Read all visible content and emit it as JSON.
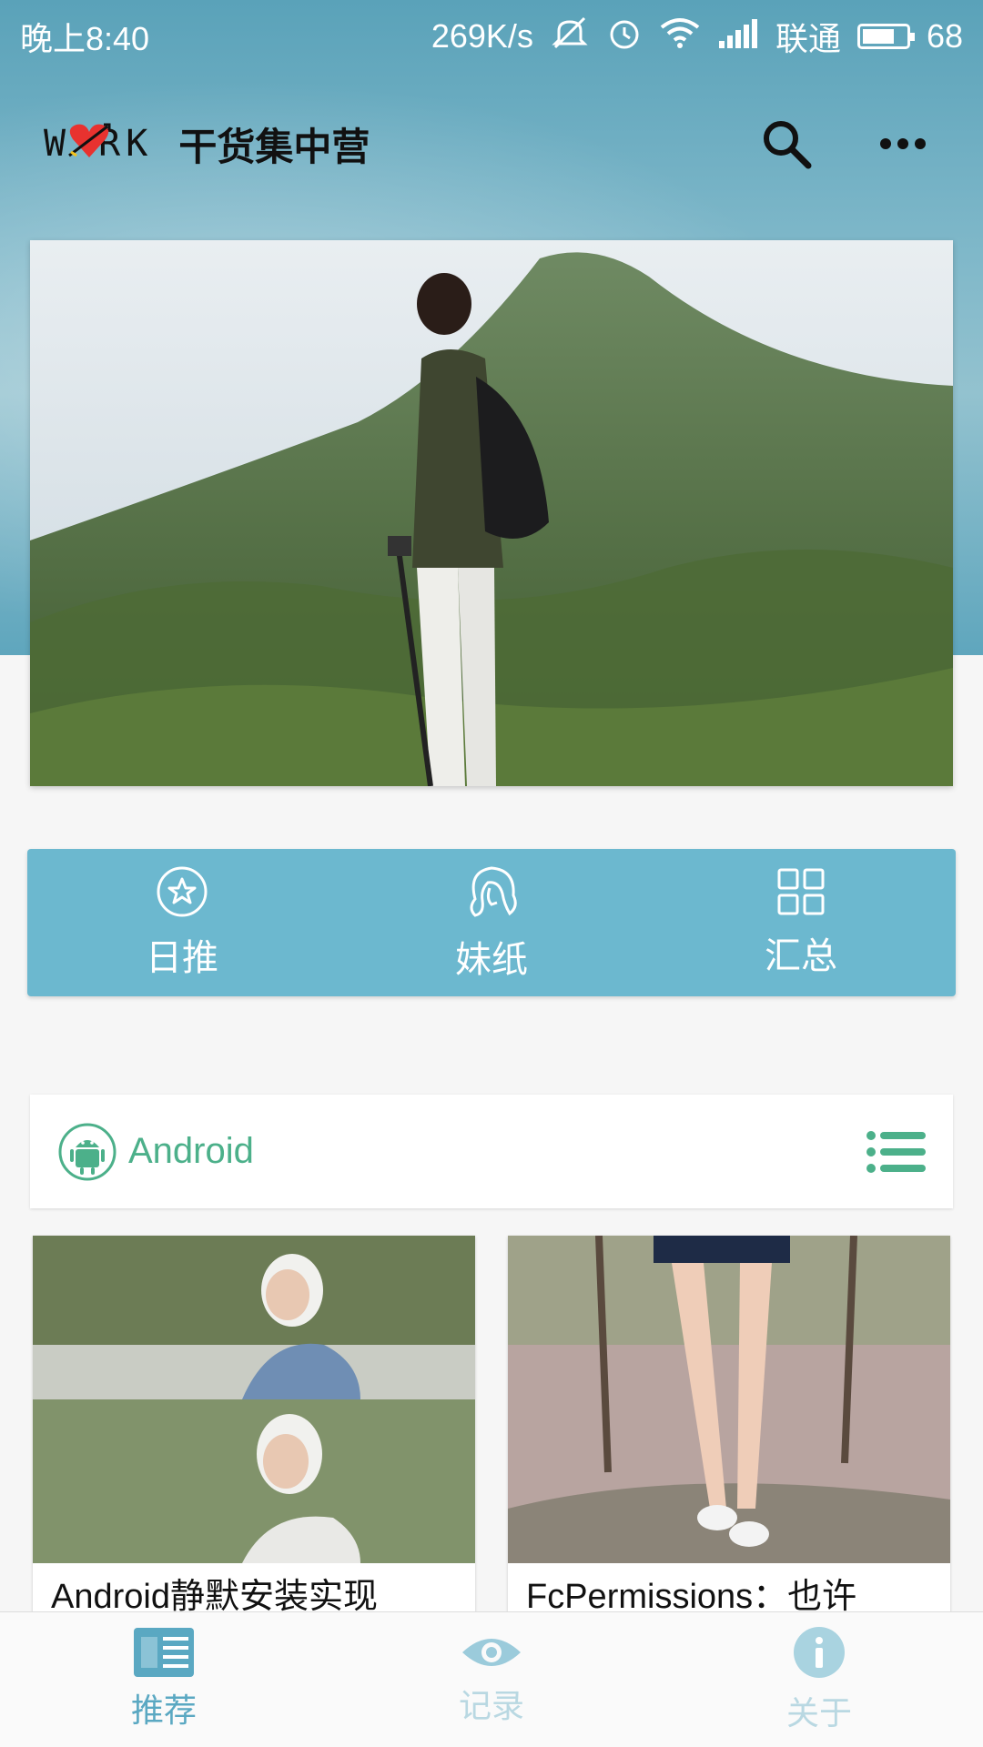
{
  "status_bar": {
    "time": "晚上8:40",
    "speed": "269K/s",
    "carrier": "联通",
    "battery": "68"
  },
  "app_bar": {
    "logo_text": "W  RK",
    "title": "干货集中营"
  },
  "tabs": [
    {
      "label": "日推",
      "icon": "star-icon"
    },
    {
      "label": "妹纸",
      "icon": "girl-icon"
    },
    {
      "label": "汇总",
      "icon": "grid-icon"
    }
  ],
  "section": {
    "title": "Android",
    "icon": "android-icon"
  },
  "cards": [
    {
      "title": "Android静默安装实现"
    },
    {
      "title": "FcPermissions：也许"
    }
  ],
  "bottom_nav": [
    {
      "label": "推荐",
      "icon": "article-icon",
      "active": true
    },
    {
      "label": "记录",
      "icon": "eye-icon",
      "active": false
    },
    {
      "label": "关于",
      "icon": "info-icon",
      "active": false
    }
  ],
  "colors": {
    "accent": "#6cb8cf",
    "android_green": "#4cb08a",
    "nav_active": "#5aa8c2"
  }
}
